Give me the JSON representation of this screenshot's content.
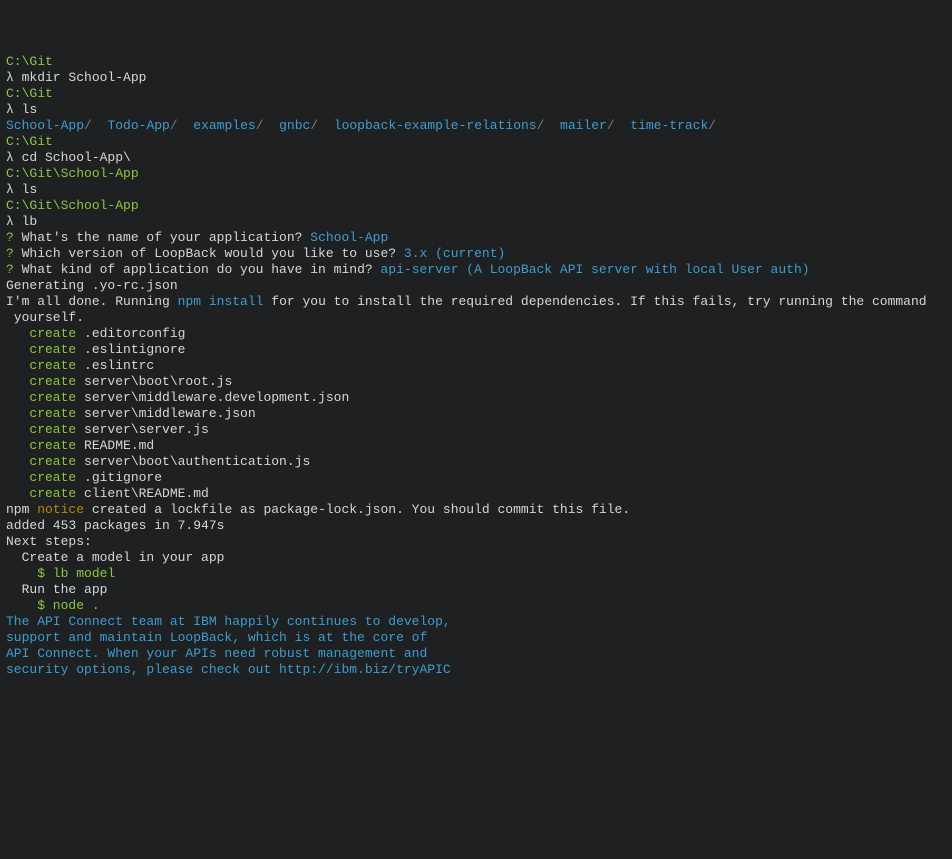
{
  "p": [
    {
      "t": "C:\\Git",
      "c": "green"
    },
    {
      "t": "λ mkdir School-App",
      "c": "white"
    },
    {
      "t": "",
      "c": "white"
    },
    {
      "t": "C:\\Git",
      "c": "green"
    },
    {
      "t": "λ ls",
      "c": "white"
    }
  ],
  "ls_items": [
    "School-App/",
    "Todo-App/",
    "examples/",
    "gnbc/",
    "loopback-example-relations/",
    "mailer/",
    "time-track/"
  ],
  "p2": [
    {
      "t": "",
      "c": "white"
    },
    {
      "t": "C:\\Git",
      "c": "green"
    },
    {
      "t": "λ cd School-App\\",
      "c": "white"
    },
    {
      "t": "",
      "c": "white"
    },
    {
      "t": "C:\\Git\\School-App",
      "c": "green"
    },
    {
      "t": "λ ls",
      "c": "white"
    },
    {
      "t": "",
      "c": "white"
    },
    {
      "t": "C:\\Git\\School-App",
      "c": "green"
    },
    {
      "t": "λ lb",
      "c": "white"
    }
  ],
  "q1": {
    "mark": "?",
    "q": " What's the name of your application? ",
    "a": "School-App"
  },
  "q2": {
    "mark": "?",
    "q": " Which version of LoopBack would you like to use? ",
    "a": "3.x (current)"
  },
  "q3": {
    "mark": "?",
    "q": " What kind of application do you have in mind? ",
    "a": "api-server (A LoopBack API server with local User auth)"
  },
  "gen": "Generating .yo-rc.json",
  "done": {
    "pre": "I'm all done. Running ",
    "npm": "npm install",
    "post": " for you to install the required dependencies. If this fails, try running the command\n yourself."
  },
  "creates": [
    ".editorconfig",
    ".eslintignore",
    ".eslintrc",
    "server\\boot\\root.js",
    "server\\middleware.development.json",
    "server\\middleware.json",
    "server\\server.js",
    "README.md",
    "server\\boot\\authentication.js",
    ".gitignore",
    "client\\README.md"
  ],
  "create_word": "create",
  "npm_line": {
    "a": "npm ",
    "b": "notice",
    "c": " created a lockfile as package-lock.json. You should commit this file."
  },
  "added": "added 453 packages in 7.947s",
  "next": "Next steps:",
  "step1": {
    "t": "  Create a model in your app",
    "cmd": "    $ lb model"
  },
  "step2": {
    "t": "  Run the app",
    "cmd": "    $ node ."
  },
  "footer": [
    "The API Connect team at IBM happily continues to develop,",
    "support and maintain LoopBack, which is at the core of",
    "API Connect. When your APIs need robust management and",
    "security options, please check out http://ibm.biz/tryAPIC"
  ]
}
